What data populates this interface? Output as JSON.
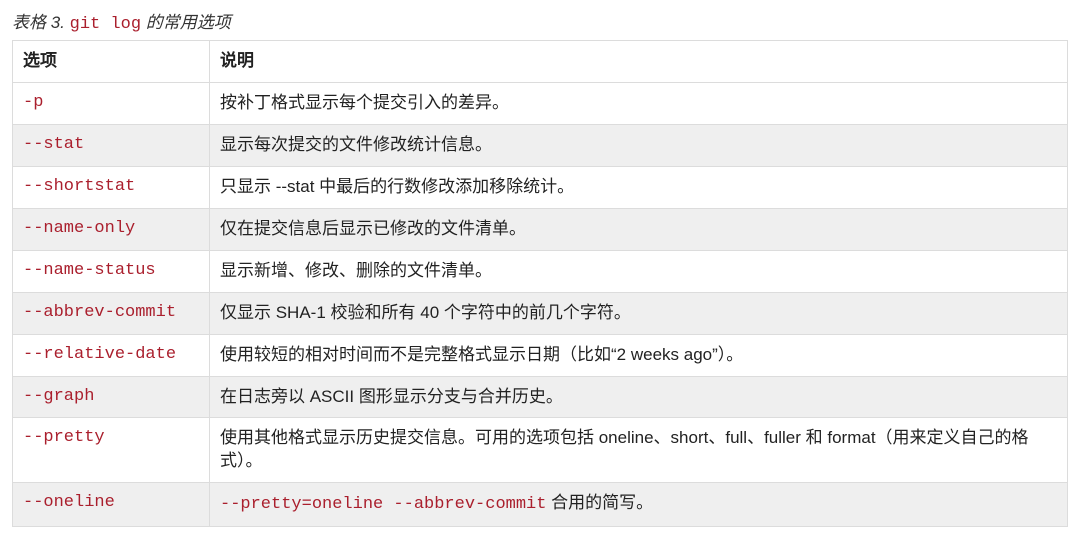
{
  "caption": {
    "prefix": "表格 3. ",
    "code": "git log",
    "suffix": " 的常用选项"
  },
  "table": {
    "headers": {
      "option": "选项",
      "description": "说明"
    },
    "rows": [
      {
        "option": "-p",
        "description": "按补丁格式显示每个提交引入的差异。"
      },
      {
        "option": "--stat",
        "description": "显示每次提交的文件修改统计信息。"
      },
      {
        "option": "--shortstat",
        "description": "只显示 --stat 中最后的行数修改添加移除统计。"
      },
      {
        "option": "--name-only",
        "description": "仅在提交信息后显示已修改的文件清单。"
      },
      {
        "option": "--name-status",
        "description": "显示新增、修改、删除的文件清单。"
      },
      {
        "option": "--abbrev-commit",
        "description": "仅显示 SHA-1 校验和所有 40 个字符中的前几个字符。"
      },
      {
        "option": "--relative-date",
        "description": "使用较短的相对时间而不是完整格式显示日期（比如“2 weeks ago”）。"
      },
      {
        "option": "--graph",
        "description": "在日志旁以 ASCII 图形显示分支与合并历史。"
      },
      {
        "option": "--pretty",
        "description": "使用其他格式显示历史提交信息。可用的选项包括 oneline、short、full、fuller 和 format（用来定义自己的格式）。"
      },
      {
        "option": "--oneline",
        "description_parts": {
          "code": "--pretty=oneline --abbrev-commit",
          "suffix": " 合用的简写。"
        }
      }
    ]
  }
}
